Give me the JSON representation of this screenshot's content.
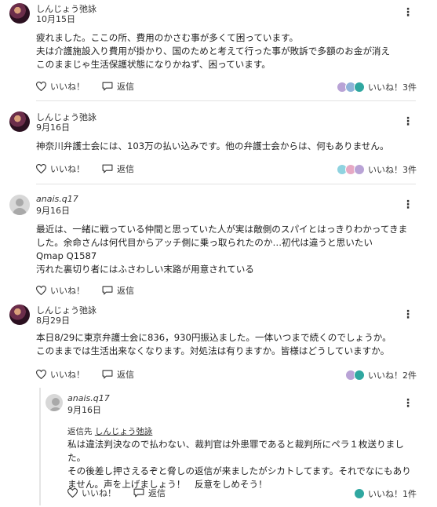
{
  "comments": [
    {
      "author": "しんじょう弛詠",
      "date": "10月15日",
      "body": "疲れました。ここの所、費用のかさむ事が多くて困っています。\n夫は介護施設入り費用が掛かり、国のためと考えて行った事が敗訴で多額のお金が消え\nこのままじゃ生活保護状態になりかねず、困っています。",
      "like_label": "いいね！",
      "reply_label": "返信",
      "likes_text": "いいね！3件"
    },
    {
      "author": "しんじょう弛詠",
      "date": "9月16日",
      "body": "神奈川弁護士会には、103万の払い込みです。他の弁護士会からは、何もありません。",
      "like_label": "いいね！",
      "reply_label": "返信",
      "likes_text": "いいね！3件"
    },
    {
      "author": "anais.q17",
      "date": "9月16日",
      "body": "最近は、一緒に戦っている仲間と思っていた人が実は敵側のスパイとはっきりわかってきました。余命さんは何代目からアッチ側に乗っ取られたのか…初代は違うと思いたい\nQmap Q1587\n汚れた裏切り者にはふさわしい末路が用意されている",
      "like_label": "いいね！",
      "reply_label": "返信"
    },
    {
      "author": "しんじょう弛詠",
      "date": "8月29日",
      "body": "本日8/29に東京弁護士会に836，930円振込ました。一体いつまで続くのでしょうか。\nこのままでは生活出来なくなります。対処法は有りますか。皆様はどうしていますか。",
      "like_label": "いいね！",
      "reply_label": "返信",
      "likes_text": "いいね！2件"
    }
  ],
  "reply": {
    "author": "anais.q17",
    "date": "9月16日",
    "reply_to_label": "返信先",
    "reply_to_name": "しんじょう弛詠",
    "body": "私は違法判決なので払わない、裁判官は外患罪であると裁判所にペラ１枚送りました。\nその後差し押さえるぞと脅しの返信が来ましたがシカトしてます。それでなにもありません。声を上げましょう！　反意をしめそう！",
    "like_label": "いいね！",
    "reply_label": "返信",
    "likes_text": "いいね！1件"
  },
  "colors": {
    "liker_purple": "#b9a3d6",
    "liker_blue": "#8fb3d9",
    "liker_teal": "#2fa7a0",
    "liker_pink": "#e6a9c4",
    "liker_cyan": "#8fd3e0"
  }
}
